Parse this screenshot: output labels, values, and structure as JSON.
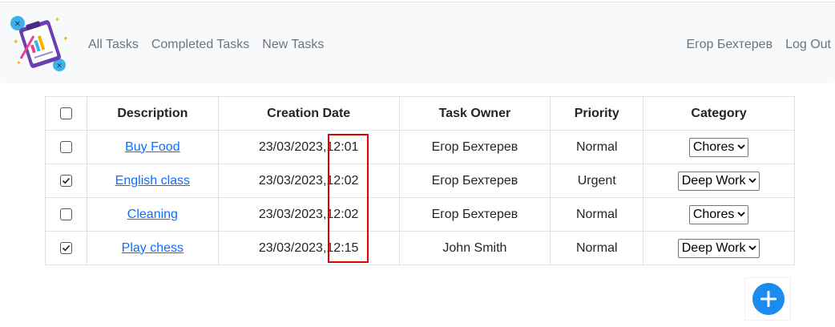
{
  "nav": {
    "links": [
      "All Tasks",
      "Completed Tasks",
      "New Tasks"
    ],
    "user_name": "Егор Бехтерев",
    "logout_label": "Log Out"
  },
  "table": {
    "headers": {
      "description": "Description",
      "creation_date": "Creation Date",
      "task_owner": "Task Owner",
      "priority": "Priority",
      "category": "Category"
    },
    "rows": [
      {
        "checked": false,
        "description": "Buy Food",
        "date": "23/03/2023,",
        "time": "12:01",
        "owner": "Егор Бехтерев",
        "priority": "Normal",
        "category": "Chores"
      },
      {
        "checked": true,
        "description": "English class",
        "date": "23/03/2023,",
        "time": "12:02",
        "owner": "Егор Бехтерев",
        "priority": "Urgent",
        "category": "Deep Work"
      },
      {
        "checked": false,
        "description": "Cleaning",
        "date": "23/03/2023,",
        "time": "12:02",
        "owner": "Егор Бехтерев",
        "priority": "Normal",
        "category": "Chores"
      },
      {
        "checked": true,
        "description": "Play chess",
        "date": "23/03/2023,",
        "time": "12:15",
        "owner": "John Smith",
        "priority": "Normal",
        "category": "Deep Work"
      }
    ]
  },
  "colors": {
    "link": "#0d6efd",
    "highlight_box": "#e00000",
    "fab": "#1a8cf0"
  },
  "icons": {
    "logo": "clipboard-checklist-logo",
    "fab": "plus-icon",
    "select": "chevron-down-icon",
    "checkbox": "checkmark-icon"
  }
}
